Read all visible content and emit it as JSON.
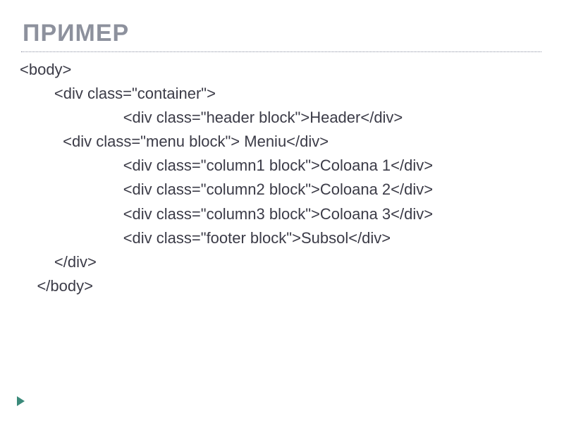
{
  "title": "ПРИМЕР",
  "code_lines": [
    "<body>",
    "        <div class=\"container\">",
    "                        <div class=\"header block\">Header</div>",
    "          <div class=\"menu block\"> Meniu</div>",
    "                        <div class=\"column1 block\">Coloana 1</div>",
    "                        <div class=\"column2 block\">Coloana 2</div>",
    "                        <div class=\"column3 block\">Coloana 3</div>",
    "                        <div class=\"footer block\">Subsol</div>",
    "        </div>",
    "    </body>"
  ]
}
